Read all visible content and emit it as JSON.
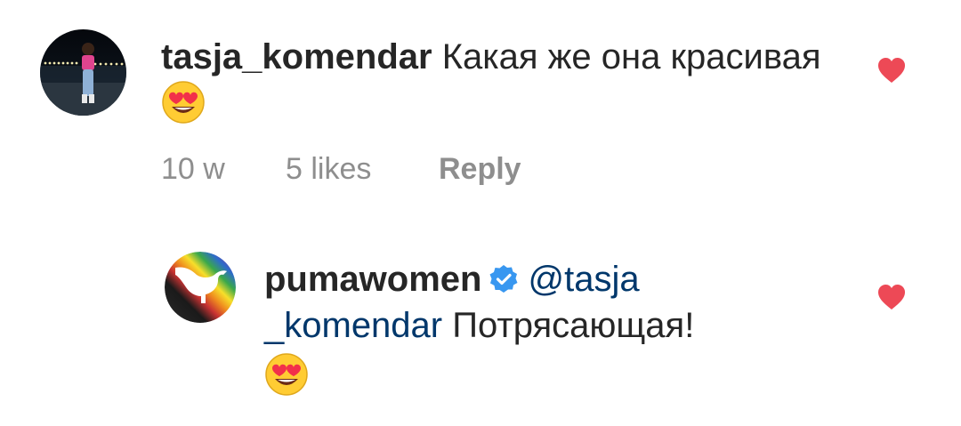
{
  "comments": [
    {
      "username": "tasja_komendar",
      "text": "Какая же она красивая",
      "emoji": "heart-eyes-emoji",
      "time": "10 w",
      "likes": "5 likes",
      "reply_label": "Reply",
      "liked": true
    }
  ],
  "reply": {
    "username": "pumawomen",
    "verified": true,
    "mention": "@tasja _komendar",
    "text": "Потрясающая!",
    "emoji": "heart-eyes-emoji",
    "liked": true
  },
  "colors": {
    "text": "#262626",
    "secondary": "#8e8e8e",
    "mention": "#00376b",
    "heart": "#ed4956",
    "verified": "#3897f0"
  }
}
